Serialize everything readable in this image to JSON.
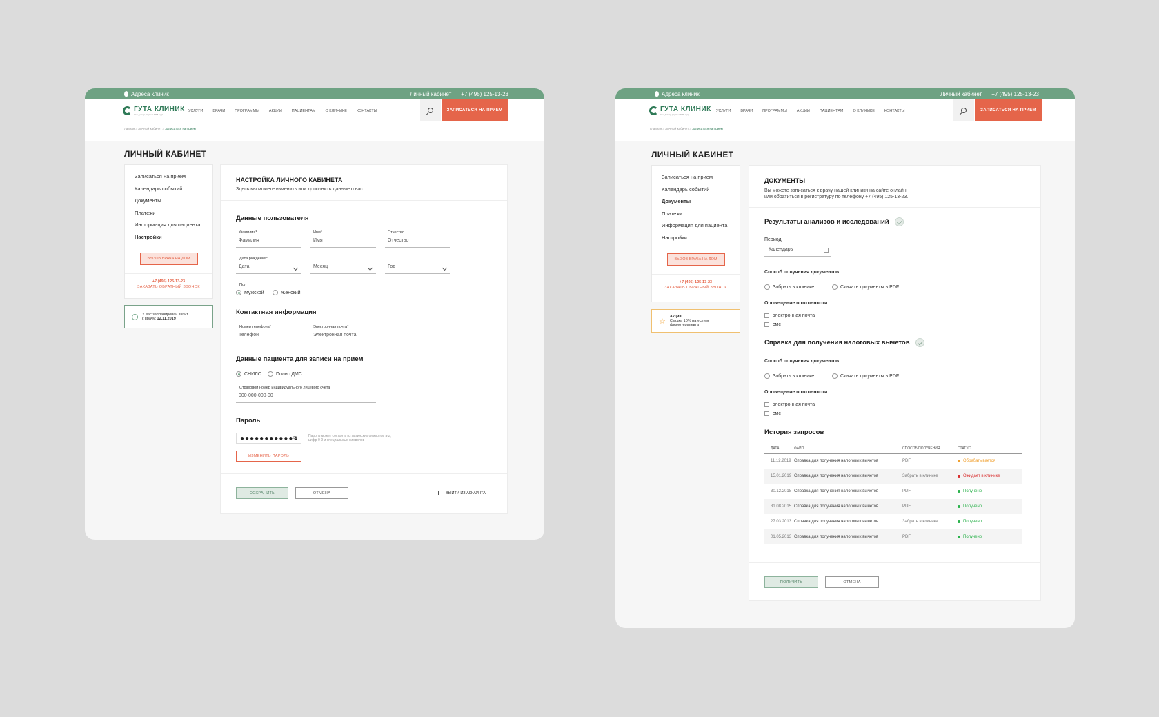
{
  "colors": {
    "brand": "#6ea283",
    "accent": "#e5654a",
    "processing": "#f0a030",
    "waiting": "#d93030",
    "received": "#2bb24c"
  },
  "header": {
    "address": "Адреса клиник",
    "account": "Личный кабинет",
    "phone": "+7 (495) 125-13-23",
    "logo_name": "ГУТА КЛИНИК",
    "logo_tagline": "ваш доктор рядом с 1996 года",
    "menu": [
      "услуги",
      "врачи",
      "программы",
      "акции",
      "пациентам",
      "о клинике",
      "контакты"
    ],
    "cta": "ЗАПИСАТЬСЯ НА ПРИЕМ",
    "search_icon": "search-icon"
  },
  "breadcrumbs": {
    "home": "Главная",
    "account": "Личный кабинет",
    "sep": " > ",
    "current": "Записаться на прием"
  },
  "page_title": "ЛИЧНЫЙ КАБИНЕТ",
  "sidebar": {
    "items": [
      "Записаться на прием",
      "Календарь событий",
      "Документы",
      "Платежи",
      "Информация для пациента",
      "Настройки"
    ],
    "home_visit": "ВЫЗОВ ВРАЧА НА ДОМ",
    "phone": "+7 (495) 125-13-23",
    "callback": "ЗАКАЗАТЬ ОБРАТНЫЙ ЗВОНОК"
  },
  "settings": {
    "notice_line1": "У вас запланирован визит",
    "notice_line2": "к врачу:",
    "notice_date": "12.11.2019",
    "title": "НАСТРОЙКА ЛИЧНОГО КАБИНЕТА",
    "subtitle": "Здесь вы можете изменить или дополнить данные о вас.",
    "user_section": "Данные пользователя",
    "lastname_label": "Фамилия*",
    "lastname": "Фамилия",
    "firstname_label": "Имя*",
    "firstname": "Имя",
    "middlename_label": "Отчество",
    "middlename": "Отчество",
    "birth_label": "Дата рождения*",
    "day": "Дата",
    "month": "Месяц",
    "year": "Год",
    "gender_label": "Пол",
    "male": "Мужской",
    "female": "Женский",
    "contact_section": "Контактная информация",
    "phone_label": "Номер телефона*",
    "phone": "Телефон",
    "email_label": "Электронная почта*",
    "email": "Электронная почта",
    "patient_section": "Данные пациента для записи на прием",
    "snils": "СНИЛС",
    "dms": "Полис ДМС",
    "snils_label": "Страховой номер индивидуального лицевого счёта",
    "snils_value": "000-000-000-00",
    "password_section": "Пароль",
    "password_value": "●●●●●●●●●●●●",
    "password_hint1": "Пароль может состоять из латинских символов a-z,",
    "password_hint2": "цифр 0-9 и специальных символов",
    "change_password": "ИЗМЕНИТЬ ПАРОЛЬ",
    "save": "СОХРАНИТЬ",
    "cancel": "ОТМЕНА",
    "logout": "ВЫЙТИ ИЗ АККАУНТА"
  },
  "documents": {
    "promo_title": "Акция",
    "promo_line1": "Скидка 10% на услуги",
    "promo_line2": "физиотерапевта",
    "title": "ДОКУМЕНТЫ",
    "subtitle1": "Вы можете записаться к врачу нашей клиники на сайте онлайн",
    "subtitle2": "или обратиться в регистратуру по телефону +7 (495) 125-13-23.",
    "results_section": "Результаты анализов и исследований",
    "period_label": "Период",
    "period_value": "Календарь",
    "method_label": "Способ получения документов",
    "pickup": "Забрать в клинике",
    "download": "Скачать документы в PDF",
    "notify_label": "Оповещение о готовности",
    "email": "электронная почта",
    "sms": "смс",
    "tax_section": "Справка для получения налоговых вычетов",
    "history_section": "История запросов",
    "columns": [
      "Дата",
      "Файл",
      "Способ получения",
      "Статус"
    ],
    "rows": [
      {
        "date": "11.12.2019",
        "file": "Справка для получения налоговых вычетов",
        "method": "PDF",
        "status": "Обрабатывается",
        "color": "#f0a030"
      },
      {
        "date": "15.01.2019",
        "file": "Справка для получения налоговых вычетов",
        "method": "Забрать в клинике",
        "status": "Ожидает в клинике",
        "color": "#d93030"
      },
      {
        "date": "30.12.2018",
        "file": "Справка для получения налоговых вычетов",
        "method": "PDF",
        "status": "Получено",
        "color": "#2bb24c"
      },
      {
        "date": "31.08.2015",
        "file": "Справка для получения налоговых вычетов",
        "method": "PDF",
        "status": "Получено",
        "color": "#2bb24c"
      },
      {
        "date": "27.03.2013",
        "file": "Справка для получения налоговых вычетов",
        "method": "Забрать в клинике",
        "status": "Получено",
        "color": "#2bb24c"
      },
      {
        "date": "01.05.2013",
        "file": "Справка для получения налоговых вычетов",
        "method": "PDF",
        "status": "Получено",
        "color": "#2bb24c"
      }
    ],
    "get": "ПОЛУЧИТЬ",
    "cancel": "ОТМЕНА"
  }
}
